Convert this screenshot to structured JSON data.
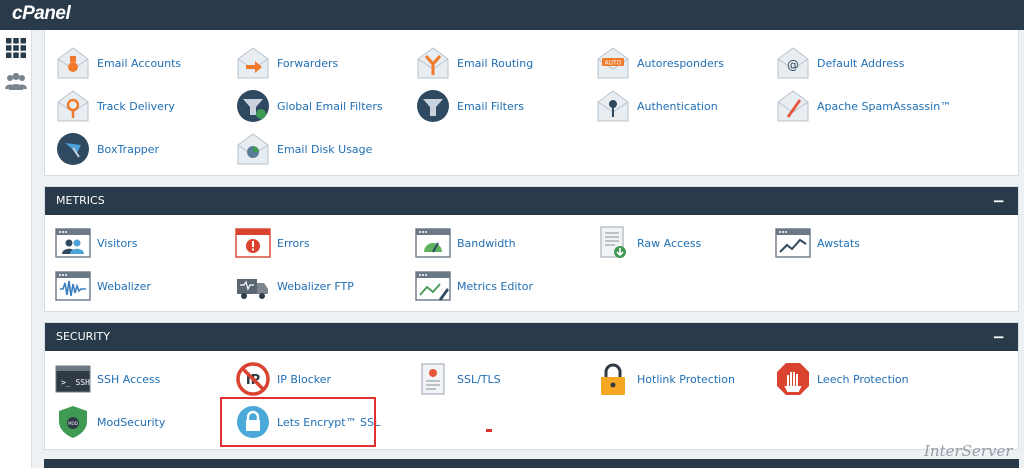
{
  "app": {
    "logo": "cPanel"
  },
  "sidebar": {
    "items": [
      {
        "icon": "grid-icon"
      },
      {
        "icon": "users-icon"
      }
    ]
  },
  "email": {
    "items": [
      {
        "label": "Email Accounts"
      },
      {
        "label": "Forwarders"
      },
      {
        "label": "Email Routing"
      },
      {
        "label": "Autoresponders"
      },
      {
        "label": "Default Address"
      },
      {
        "label": "Track Delivery"
      },
      {
        "label": "Global Email Filters"
      },
      {
        "label": "Email Filters"
      },
      {
        "label": "Authentication"
      },
      {
        "label": "Apache SpamAssassin™"
      },
      {
        "label": "BoxTrapper"
      },
      {
        "label": "Email Disk Usage"
      }
    ]
  },
  "metrics": {
    "title": "METRICS",
    "collapse": "−",
    "items": [
      {
        "label": "Visitors"
      },
      {
        "label": "Errors"
      },
      {
        "label": "Bandwidth"
      },
      {
        "label": "Raw Access"
      },
      {
        "label": "Awstats"
      },
      {
        "label": "Webalizer"
      },
      {
        "label": "Webalizer FTP"
      },
      {
        "label": "Metrics Editor"
      }
    ]
  },
  "security": {
    "title": "SECURITY",
    "collapse": "−",
    "items": [
      {
        "label": "SSH Access"
      },
      {
        "label": "IP Blocker"
      },
      {
        "label": "SSL/TLS"
      },
      {
        "label": "Hotlink Protection"
      },
      {
        "label": "Leech Protection"
      },
      {
        "label": "ModSecurity"
      },
      {
        "label": "Lets Encrypt™ SSL"
      }
    ]
  },
  "watermark": "InterServer",
  "colors": {
    "header": "#293a4a",
    "link": "#1f6fb5",
    "highlight": "#e03131"
  }
}
